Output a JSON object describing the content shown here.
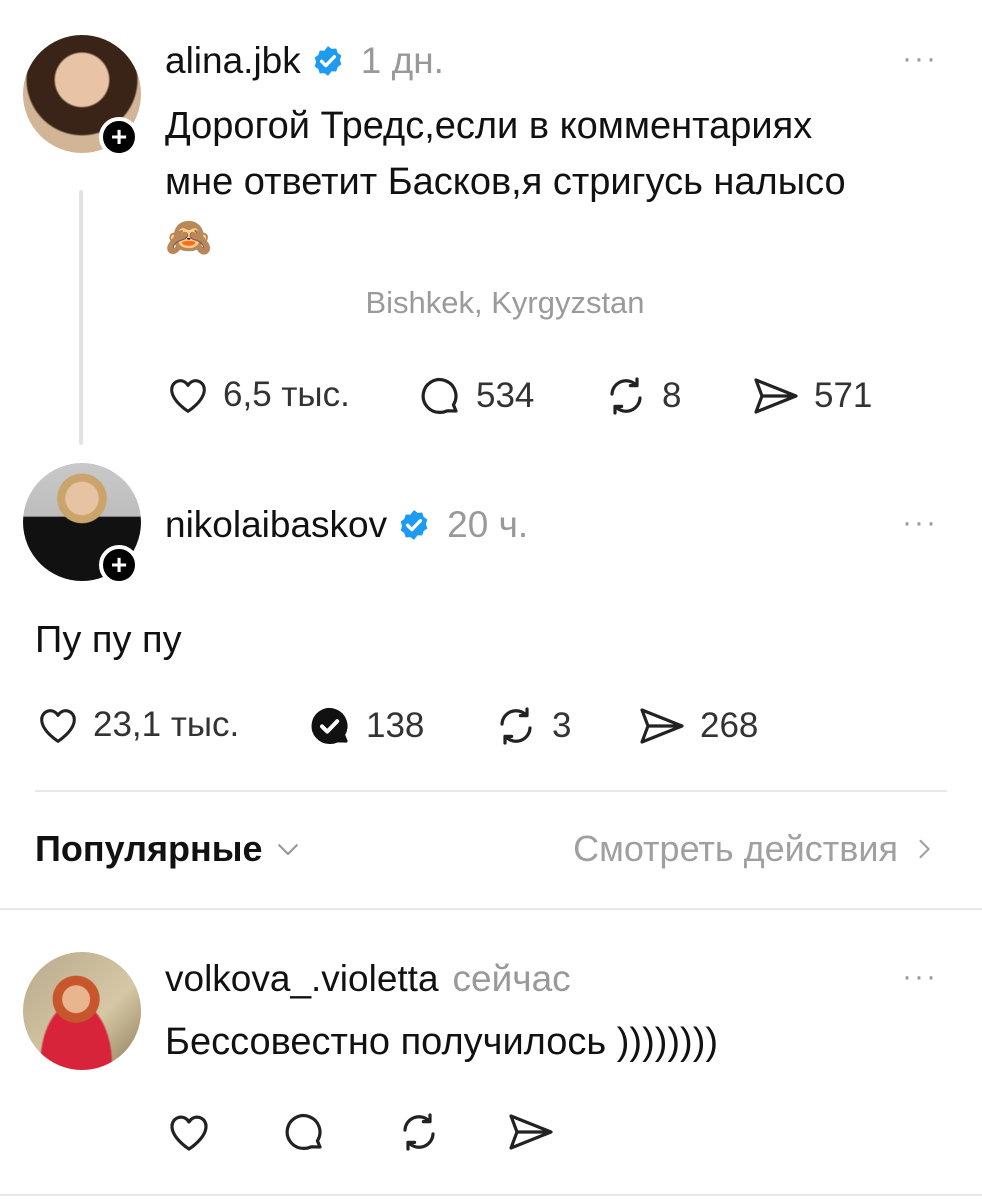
{
  "posts": [
    {
      "username": "alina.jbk",
      "verified": true,
      "time": "1 дн.",
      "text_line1": "Дорогой Тредс,если в комментариях",
      "text_line2": "мне ответит Басков,я стригусь налысо",
      "emoji": "🙈",
      "location": "Bishkek, Kyrgyzstan",
      "likes": "6,5 тыс.",
      "replies": "534",
      "reposts": "8",
      "shares": "571"
    },
    {
      "username": "nikolaibaskov",
      "verified": true,
      "time": "20 ч.",
      "text": "Пу пу пу",
      "likes": "23,1 тыс.",
      "replies": "138",
      "reposts": "3",
      "shares": "268"
    }
  ],
  "sort_bar": {
    "sort_label": "Популярные",
    "activity_label": "Смотреть действия"
  },
  "reply": {
    "username": "volkova_.violetta",
    "time": "сейчас",
    "text": "Бессовестно получилось ))))))))"
  },
  "more_icon": "···",
  "plus_icon": "+",
  "colors": {
    "verified": "#1d9bf0",
    "muted": "#999999",
    "text": "#111111"
  }
}
